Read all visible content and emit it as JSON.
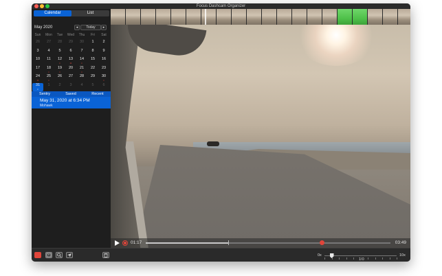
{
  "window": {
    "title": "Focus Dashcam Organizer"
  },
  "sidebar": {
    "segments": {
      "calendar": "Calendar",
      "list": "List"
    },
    "month": "May 2020",
    "nav": {
      "prev": "◂",
      "today": "Today",
      "next": "▸"
    },
    "weekdays": [
      "Sun",
      "Mon",
      "Tue",
      "Wed",
      "Thu",
      "Fri",
      "Sat"
    ],
    "weeks": [
      [
        {
          "d": "26",
          "dim": true
        },
        {
          "d": "27",
          "dim": true
        },
        {
          "d": "28",
          "dim": true
        },
        {
          "d": "29",
          "dim": true
        },
        {
          "d": "30",
          "dim": true
        },
        {
          "d": "1"
        },
        {
          "d": "2"
        }
      ],
      [
        {
          "d": "3"
        },
        {
          "d": "4"
        },
        {
          "d": "5"
        },
        {
          "d": "6"
        },
        {
          "d": "7"
        },
        {
          "d": "8"
        },
        {
          "d": "9"
        }
      ],
      [
        {
          "d": "10"
        },
        {
          "d": "11"
        },
        {
          "d": "12",
          "dots": "•"
        },
        {
          "d": "13",
          "dots": "••"
        },
        {
          "d": "14",
          "dots": "•"
        },
        {
          "d": "15"
        },
        {
          "d": "16"
        }
      ],
      [
        {
          "d": "17"
        },
        {
          "d": "18",
          "dots": "•"
        },
        {
          "d": "19",
          "dots": "•"
        },
        {
          "d": "20"
        },
        {
          "d": "21",
          "dots": "•"
        },
        {
          "d": "22"
        },
        {
          "d": "23"
        }
      ],
      [
        {
          "d": "24",
          "dots": "••"
        },
        {
          "d": "25",
          "dots": "•"
        },
        {
          "d": "26"
        },
        {
          "d": "27"
        },
        {
          "d": "28"
        },
        {
          "d": "29"
        },
        {
          "d": "30",
          "dots": "•"
        }
      ],
      [
        {
          "d": "31",
          "dots": "•",
          "selected": true
        },
        {
          "d": "1",
          "dim": true
        },
        {
          "d": "2",
          "dim": true
        },
        {
          "d": "3",
          "dim": true
        },
        {
          "d": "4",
          "dim": true
        },
        {
          "d": "5",
          "dim": true
        },
        {
          "d": "6",
          "dim": true
        }
      ]
    ],
    "filters": [
      "Sentry",
      "Saved",
      "Recent"
    ],
    "event": {
      "time": "May 31, 2020 at 6:34 PM",
      "location": "Mohawk"
    }
  },
  "player": {
    "current_time": "01:17",
    "duration": "03:49",
    "progress_fraction": 0.336,
    "marker_fraction": 0.72
  },
  "bottom": {
    "speed_min": "0x",
    "speed_max": "10x",
    "speed_value": "1.0",
    "speed_fraction": 0.1
  },
  "colors": {
    "accent": "#0a63d6",
    "record": "#e0453a",
    "thumb_active": "#4fc14a"
  },
  "icons": {
    "toolbar": [
      "sentry-record-icon",
      "export-icon",
      "search-icon",
      "location-arrow-icon",
      "trash-icon"
    ]
  }
}
